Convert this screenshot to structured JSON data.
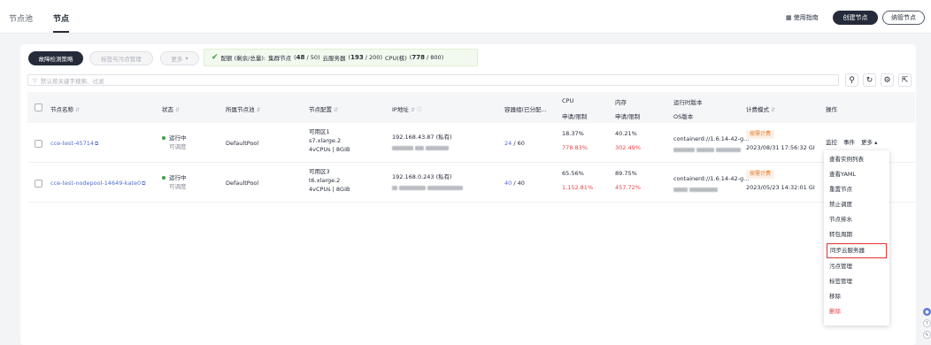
{
  "header": {
    "tabs": [
      {
        "label": "节点池"
      },
      {
        "label": "节点"
      }
    ],
    "guide": "使用指南",
    "create": "创建节点",
    "manage": "纳管节点"
  },
  "toolbar": {
    "fault": "故障检测策略",
    "taint": "标签与污点管理",
    "more": "更多",
    "quota": {
      "prefix": "配额 (剩余/总量):",
      "cluster_label": "集群节点",
      "cluster_used": "48",
      "cluster_total": "/ 50)",
      "cloud_label": "云服务器",
      "cloud_used": "193",
      "cloud_total": "/ 200)",
      "cpu_label": "CPU(核)",
      "cpu_used": "778",
      "cpu_total": "/ 800)"
    }
  },
  "search": {
    "placeholder": "默认按关键字搜索、过滤"
  },
  "table": {
    "headers": {
      "name": "节点名称",
      "status": "状态",
      "pool": "所属节点池",
      "config": "节点配置",
      "ip": "IP地址",
      "pods": "容器组(已分配...",
      "cpu": "CPU",
      "cpu_sub": "申请/限制",
      "mem": "内存",
      "mem_sub": "申请/限制",
      "runtime": "运行时版本",
      "runtime_sub": "OS版本",
      "billing": "计费模式",
      "ops": "操作"
    },
    "rows": [
      {
        "name": "cce-test-45714",
        "status": "运行中",
        "schedule": "可调度",
        "pool": "DefaultPool",
        "zone": "可用区1",
        "flavor": "s7.xlarge.2",
        "spec": "4vCPUs | 8GiB",
        "ip": "192.168.43.87 (私有)",
        "pods_used": "24",
        "pods_total": "/ 60",
        "cpu_req": "18.37%",
        "cpu_lim": "778.83%",
        "mem_req": "40.21%",
        "mem_lim": "302.49%",
        "runtime": "containerd://1.6.14-42-g...",
        "billing": "按需计费",
        "created": "2023/08/31 17:56:32 GI",
        "op_monitor": "监控",
        "op_event": "事件",
        "op_more": "更多"
      },
      {
        "name": "cce-test-nodepool-14649-kate0",
        "status": "运行中",
        "schedule": "可调度",
        "pool": "DefaultPool",
        "zone": "可用区3",
        "flavor": "t6.xlarge.2",
        "spec": "4vCPUs | 8GiB",
        "ip": "192.168.0.243 (私有)",
        "pods_used": "40",
        "pods_total": "/ 40",
        "cpu_req": "65.56%",
        "cpu_lim": "1,152.81%",
        "mem_req": "89.75%",
        "mem_lim": "457.72%",
        "runtime": "containerd://1.6.14-42-g...",
        "billing": "按需计费",
        "created": "2023/05/23 14:32:01 GI"
      }
    ]
  },
  "menu": {
    "items": [
      {
        "label": "查看实例列表"
      },
      {
        "label": "查看YAML"
      },
      {
        "label": "重置节点"
      },
      {
        "label": "禁止调度"
      },
      {
        "label": "节点排水"
      },
      {
        "label": "转包周期"
      },
      {
        "label": "同步云服务器"
      },
      {
        "label": "污点管理"
      },
      {
        "label": "标签管理"
      },
      {
        "label": "移除"
      },
      {
        "label": "删除"
      }
    ]
  }
}
